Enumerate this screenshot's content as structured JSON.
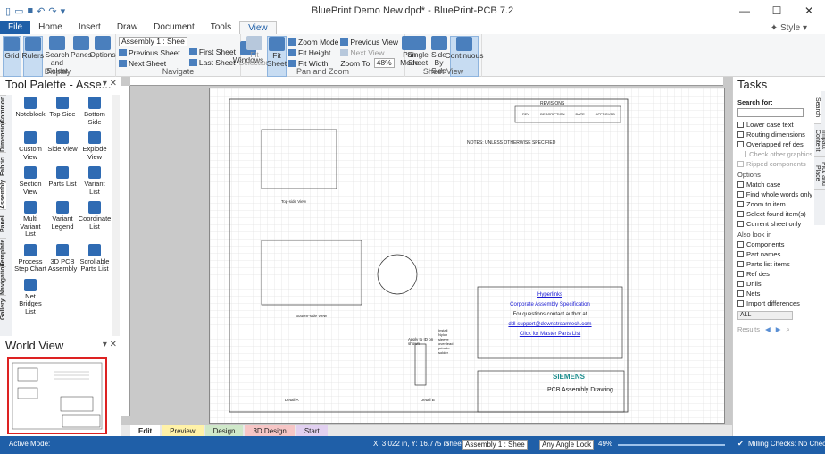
{
  "window": {
    "title": "BluePrint Demo New.dpd* - BluePrint-PCB 7.2",
    "style_label": "Style"
  },
  "tabs": [
    "File",
    "Home",
    "Insert",
    "Draw",
    "Document",
    "Tools",
    "View"
  ],
  "ribbon": {
    "display": {
      "label": "Display",
      "grid": "Grid",
      "rulers": "Rulers",
      "search": "Search and Select",
      "panes": "Panes",
      "options": "Options"
    },
    "navigate": {
      "label": "Navigate",
      "sheet_value": "Assembly 1 : Shee",
      "previous": "Previous Sheet",
      "next": "Next Sheet",
      "first": "First Sheet",
      "last": "Last Sheet",
      "windows": "Windows"
    },
    "panzoom": {
      "label": "Pan and Zoom",
      "fit_selection": "Fit Selection",
      "fit_sheet": "Fit Sheet",
      "zoom_mode": "Zoom Mode",
      "fit_height": "Fit Height",
      "fit_width": "Fit Width",
      "prev_view": "Previous View",
      "next_view": "Next View",
      "zoom_to": "Zoom To:",
      "zoom_value": "48%",
      "pan_mode": "Pan Mode"
    },
    "sheetview": {
      "label": "Sheet View",
      "single": "Single Sheet",
      "side": "Side By Side",
      "continuous": "Continuous"
    }
  },
  "tool_palette": {
    "title": "Tool Palette - Asse...",
    "vtabs": [
      "Common",
      "Dimension",
      "Fabric",
      "Assembly",
      "Panel",
      "Template",
      "Navigation",
      "Gallery"
    ],
    "tools": [
      "Noteblock",
      "Top Side",
      "Bottom Side",
      "Custom View",
      "Side View",
      "Explode View",
      "Section View",
      "Parts List",
      "Variant List",
      "Multi Variant List",
      "Variant Legend",
      "Coordinate List",
      "Process Step Chart",
      "3D PCB Assembly",
      "Scrollable Parts List",
      "Net Bridges List"
    ]
  },
  "world_view": {
    "title": "World View"
  },
  "sheet_tabs": [
    "Edit",
    "Preview",
    "Design",
    "3D Design",
    "Start"
  ],
  "drawing": {
    "revisions": "REVISIONS",
    "rev_cols": [
      "REV",
      "DESCRIPTION",
      "DATE",
      "APPROVED"
    ],
    "notes_title": "NOTES: UNLESS OTHERWISE SPECIFIED",
    "top_view": "Top-side View",
    "bottom_view": "Bottom-side View",
    "detail_a": "Detail A",
    "detail_b": "Detail B",
    "hyperlinks": "Hyperlinks",
    "link1": "Corporate Assembly Specification",
    "contact": "For questions contact author at",
    "email": "ddl-support@downstreamtech.com",
    "link2": "Click for Master Parts List",
    "company": "SIEMENS",
    "drawing_title": "PCB Assembly Drawing",
    "apply_note": "Apply to ID on shown",
    "install_note": "Install Nylon sleeve over lead prior to solder"
  },
  "tasks": {
    "title": "Tasks",
    "vtabs": [
      "Search",
      "Impact Content",
      "Pick and Place"
    ],
    "search_for": "Search for:",
    "opts1": [
      "Lower case text",
      "Routing dimensions",
      "Overlapped ref des",
      "Check other graphics",
      "Ripped components"
    ],
    "options_label": "Options",
    "opts2": [
      "Match case",
      "Find whole words only",
      "Zoom to item",
      "Select found item(s)",
      "Current sheet only"
    ],
    "also_label": "Also look in",
    "opts3": [
      "Components",
      "Part names",
      "Parts list items",
      "Ref des",
      "Drills",
      "Nets",
      "Import differences"
    ],
    "input_val": "ALL",
    "results": "Results"
  },
  "status": {
    "active_mode": "Active Mode:",
    "coords": "X: 3.022 in, Y: 16.775 in",
    "sheet_label": "Sheet:",
    "sheet_value": "Assembly 1 : Shee",
    "angle": "Any Angle Lock",
    "zoom": "49%",
    "milling": "Milling Checks: No Checking"
  }
}
